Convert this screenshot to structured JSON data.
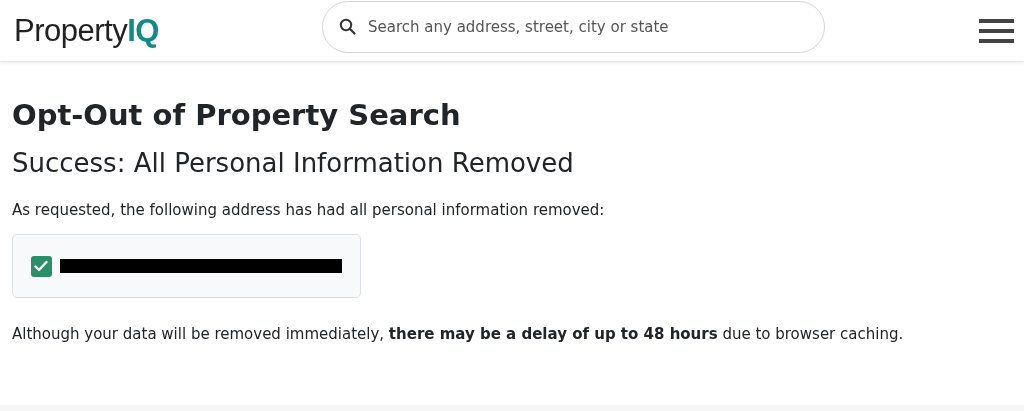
{
  "header": {
    "logo": {
      "text": "Property",
      "accent": "IQ"
    },
    "search": {
      "placeholder": "Search any address, street, city or state"
    }
  },
  "page": {
    "title": "Opt-Out of Property Search",
    "subtitle": "Success: All Personal Information Removed",
    "intro": "As requested, the following address has had all personal information removed:",
    "addresses": [
      {
        "checked": true,
        "redacted": true
      }
    ],
    "note": "Although your data will be removed immediately, **there may be a delay of up to 48 hours** due to browser caching."
  }
}
